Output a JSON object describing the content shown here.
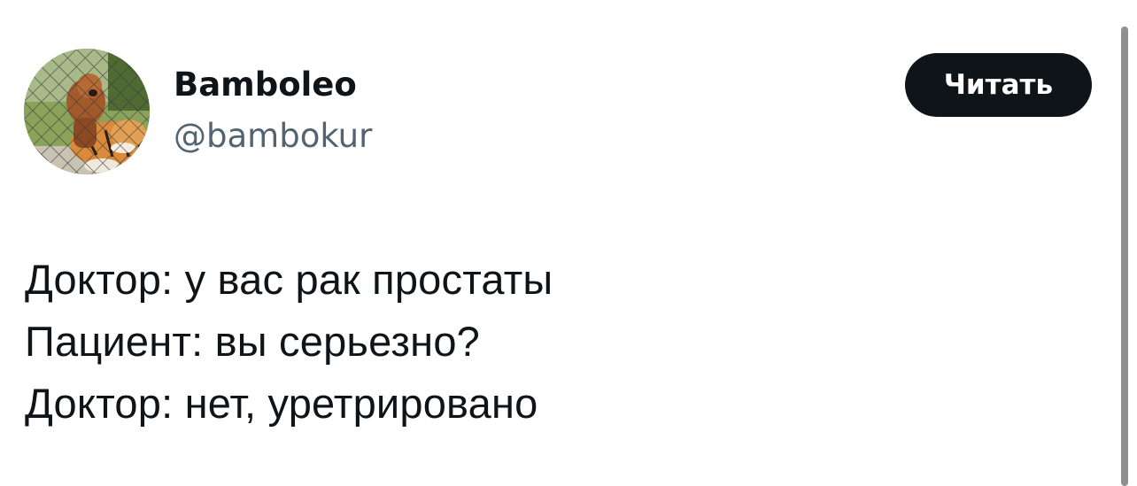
{
  "author": {
    "display_name": "Bamboleo",
    "handle": "@bambokur",
    "avatar_description": "tiger-and-dog-avatar"
  },
  "follow_button": {
    "label": "Читать"
  },
  "tweet": {
    "lines": [
      "Доктор: у вас рак простаты",
      "Пациент: вы серьезно?",
      "Доктор: нет, уретрировано"
    ]
  },
  "colors": {
    "text_primary": "#0f1419",
    "text_secondary": "#536471",
    "button_background": "#0f1419",
    "button_text": "#ffffff",
    "background": "#ffffff"
  }
}
